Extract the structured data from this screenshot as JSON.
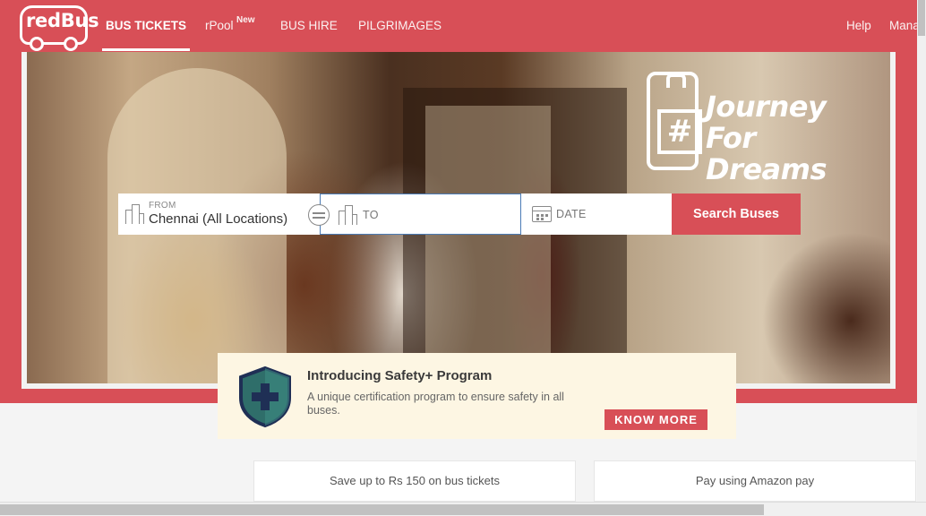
{
  "brand": {
    "logo_text": "redBus"
  },
  "nav": {
    "items": [
      {
        "label": "BUS TICKETS"
      },
      {
        "label": "rPool",
        "badge": "New"
      },
      {
        "label": "BUS HIRE"
      },
      {
        "label": "PILGRIMAGES"
      }
    ],
    "right": [
      {
        "label": "Help"
      },
      {
        "label": "Mana"
      }
    ]
  },
  "hero": {
    "campaign": {
      "hash": "#",
      "line1": "Journey",
      "line2": "For",
      "line3": "Dreams"
    }
  },
  "search": {
    "from_label": "FROM",
    "from_value": "Chennai (All Locations)",
    "to_placeholder": "TO",
    "date_placeholder": "DATE",
    "button_label": "Search Buses"
  },
  "safety": {
    "title": "Introducing Safety+ Program",
    "description": "A unique certification program to ensure safety in all buses.",
    "cta": "KNOW MORE"
  },
  "offers": [
    {
      "text": "Save up to Rs 150 on bus tickets"
    },
    {
      "text": "Pay using Amazon pay"
    }
  ],
  "colors": {
    "brand": "#d84f57",
    "shield": "#2f4f5a",
    "shield_stroke": "#1f2f55",
    "safety_bg": "#fdf6e3"
  },
  "icons": [
    "building-icon",
    "swap-icon",
    "calendar-icon",
    "shield-plus-icon",
    "suitcase-icon"
  ]
}
